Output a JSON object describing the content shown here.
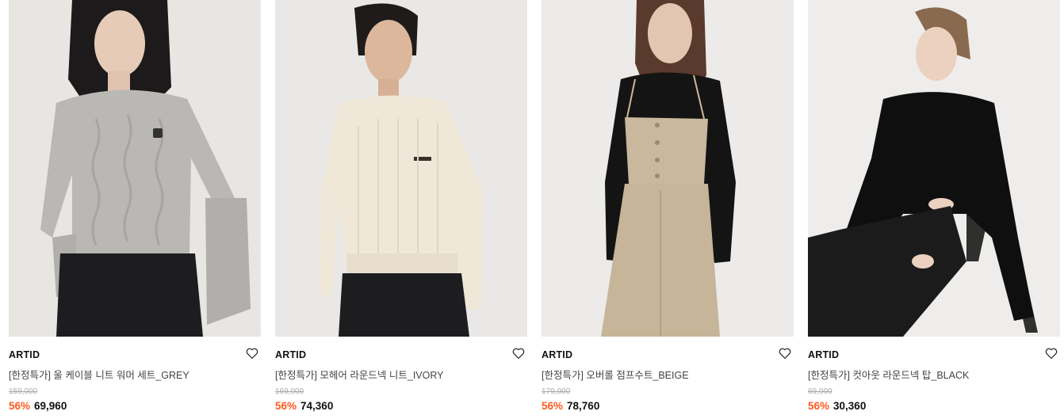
{
  "products": [
    {
      "brand": "ARTID",
      "title": "[한정특가] 울 케이블 니트 워머 세트_GREY",
      "original_price": "159,000",
      "discount": "56%",
      "price": "69,960",
      "wishlist_icon": "heart-outline-icon",
      "photo_bg": "#e7e6e3"
    },
    {
      "brand": "ARTID",
      "title": "[한정특가] 모헤어 라운드넥 니트_IVORY",
      "original_price": "169,000",
      "discount": "56%",
      "price": "74,360",
      "wishlist_icon": "heart-outline-icon",
      "photo_bg": "#e9e8e6"
    },
    {
      "brand": "ARTID",
      "title": "[한정특가] 오버롤 점프수트_BEIGE",
      "original_price": "179,000",
      "discount": "56%",
      "price": "78,760",
      "wishlist_icon": "heart-outline-icon",
      "photo_bg": "#ecebe9"
    },
    {
      "brand": "ARTID",
      "title": "[한정특가] 컷아웃 라운드넥 탑_BLACK",
      "original_price": "69,000",
      "discount": "56%",
      "price": "30,360",
      "wishlist_icon": "heart-outline-icon",
      "photo_bg": "#eeedeb"
    }
  ],
  "colors": {
    "discount": "#ff5a1f",
    "text": "#111111",
    "muted": "#aaaaaa"
  }
}
